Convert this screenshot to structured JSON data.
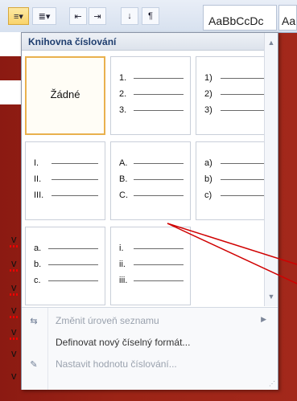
{
  "colors": {
    "accent": "#c00000",
    "header_text": "#1e3d6e",
    "selected_border": "#e9b14e"
  },
  "ribbon": {
    "style_sample": "AaBbCcDc",
    "style_sample2": "Aa",
    "buttons": [
      "numbering-icon",
      "multilevel-list-icon",
      "decrease-indent-icon",
      "increase-indent-icon",
      "sort-icon",
      "pilcrow-icon"
    ]
  },
  "document": {
    "fragment_letter": "v"
  },
  "panel": {
    "title": "Knihovna číslování",
    "tiles": [
      {
        "type": "none",
        "label": "Žádné"
      },
      {
        "type": "list",
        "markers": [
          "1.",
          "2.",
          "3."
        ]
      },
      {
        "type": "list",
        "markers": [
          "1)",
          "2)",
          "3)"
        ]
      },
      {
        "type": "list",
        "markers": [
          "I.",
          "II.",
          "III."
        ]
      },
      {
        "type": "list",
        "markers": [
          "A.",
          "B.",
          "C."
        ]
      },
      {
        "type": "list",
        "markers": [
          "a)",
          "b)",
          "c)"
        ]
      },
      {
        "type": "list",
        "markers": [
          "a.",
          "b.",
          "c."
        ]
      },
      {
        "type": "list",
        "markers": [
          "i.",
          "ii.",
          "iii."
        ]
      }
    ]
  },
  "menu": {
    "change_level": "Změnit úroveň seznamu",
    "define_format": "Definovat nový číselný formát...",
    "set_value": "Nastavit hodnotu číslování..."
  }
}
